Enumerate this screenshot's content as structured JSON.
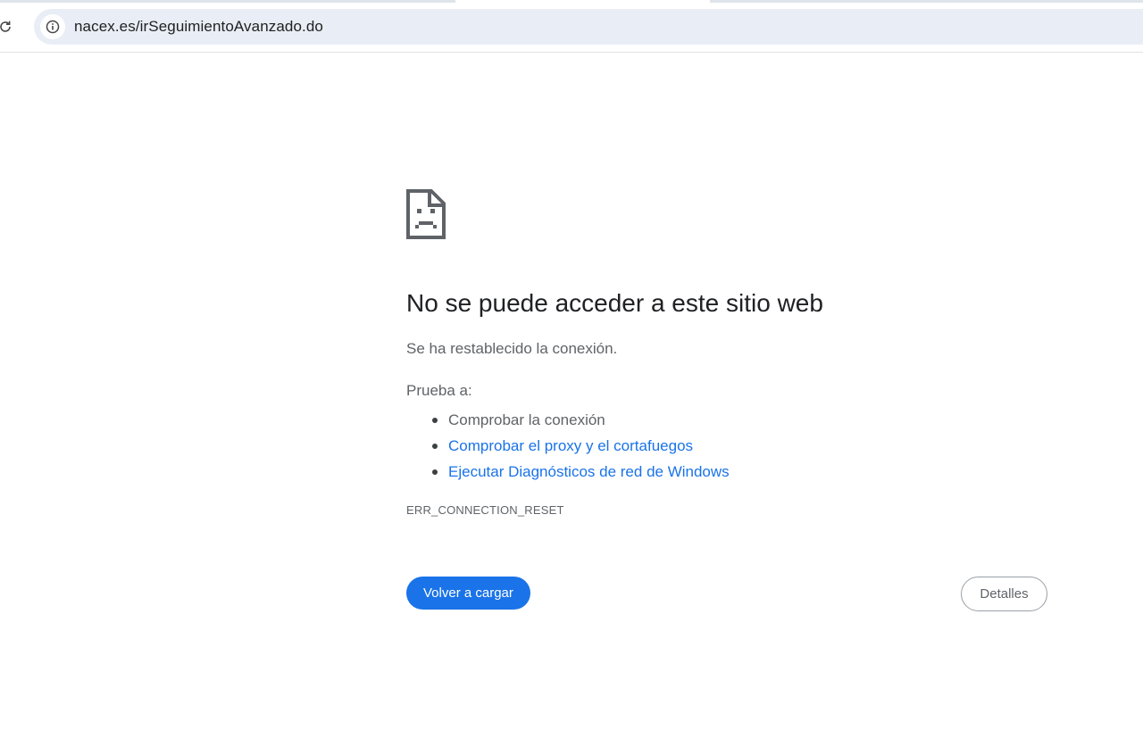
{
  "browser": {
    "url": "nacex.es/irSeguimientoAvanzado.do",
    "reload_icon": "reload-icon",
    "site_info_icon": "info-icon"
  },
  "error_page": {
    "icon": "sad-document-icon",
    "headline": "No se puede acceder a este sitio web",
    "description": "Se ha restablecido la conexión.",
    "try_label": "Prueba a:",
    "suggestions": [
      "Comprobar la conexión",
      "Comprobar el proxy y el cortafuegos",
      "Ejecutar Diagnósticos de red de Windows"
    ],
    "error_code": "ERR_CONNECTION_RESET",
    "reload_button": "Volver a cargar",
    "details_button": "Detalles"
  },
  "colors": {
    "accent": "#1a73e8",
    "text_primary": "#202124",
    "text_secondary": "#5f6368",
    "omnibox_bg": "#e9eef6"
  }
}
